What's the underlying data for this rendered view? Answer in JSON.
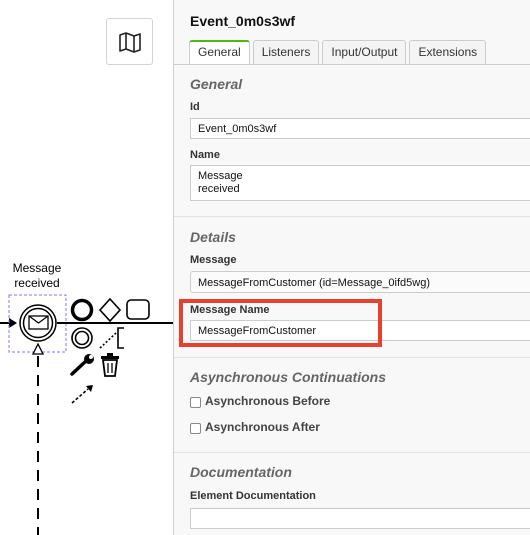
{
  "canvas": {
    "event_label": "Message\nreceived",
    "minimap_icon": "map-icon",
    "context_pad_icons": [
      "end-event-icon",
      "gateway-icon",
      "task-icon",
      "intermediate-event-icon",
      "text-annotation-icon",
      "wrench-icon",
      "trash-icon",
      "connect-arrow-icon"
    ]
  },
  "panel": {
    "title": "Event_0m0s3wf",
    "tabs": [
      {
        "label": "General",
        "active": true
      },
      {
        "label": "Listeners",
        "active": false
      },
      {
        "label": "Input/Output",
        "active": false
      },
      {
        "label": "Extensions",
        "active": false
      }
    ],
    "groups": {
      "general": "General",
      "details": "Details",
      "async": "Asynchronous Continuations",
      "documentation": "Documentation"
    },
    "fields": {
      "id_label": "Id",
      "id_value": "Event_0m0s3wf",
      "name_label": "Name",
      "name_value": "Message\nreceived",
      "message_label": "Message",
      "message_value": "MessageFromCustomer (id=Message_0ifd5wg)",
      "message_name_label": "Message Name",
      "message_name_value": "MessageFromCustomer",
      "async_before_label": "Asynchronous Before",
      "async_after_label": "Asynchronous After",
      "element_doc_label": "Element Documentation",
      "element_doc_value": ""
    }
  },
  "colors": {
    "highlight": "#e8402e",
    "active_tab_accent": "#52b415",
    "selection_dash": "#7a7aff"
  }
}
